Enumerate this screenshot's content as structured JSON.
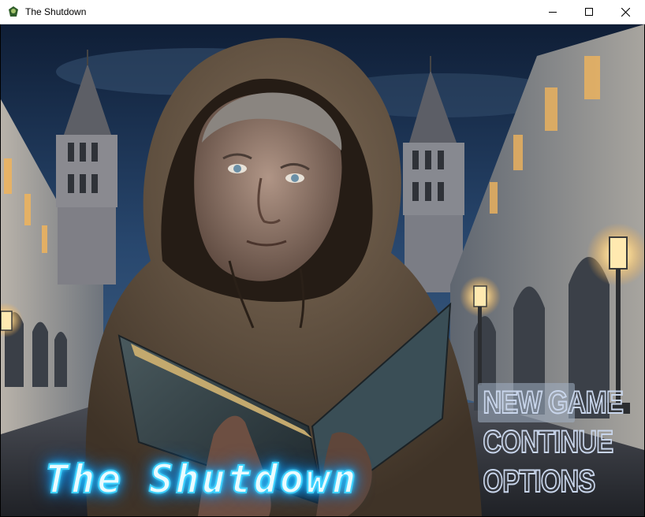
{
  "window": {
    "title": "The Shutdown",
    "icons": [
      "app-icon",
      "minimize-icon",
      "maximize-icon",
      "close-icon"
    ]
  },
  "game": {
    "title": "The Shutdown",
    "title_glow_color": "#16bfff",
    "menu": {
      "items": [
        {
          "label": "NEW GAME",
          "selected": true
        },
        {
          "label": "CONTINUE",
          "selected": false
        },
        {
          "label": "OPTIONS",
          "selected": false
        }
      ]
    },
    "colors": {
      "sky": "#1d3556",
      "stone": "#8c8f92",
      "robe": "#6b5744",
      "book": "#2c3c44"
    }
  }
}
